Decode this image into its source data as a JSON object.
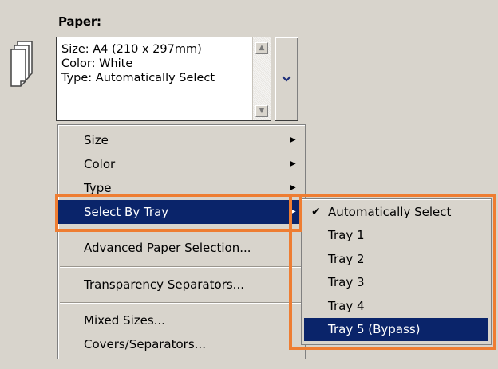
{
  "paper": {
    "title": "Paper:",
    "summary_lines": [
      "Size: A4 (210 x 297mm)",
      "Color: White",
      "Type: Automatically Select"
    ]
  },
  "menu": {
    "items": [
      {
        "label": "Size",
        "submenu": true
      },
      {
        "label": "Color",
        "submenu": true
      },
      {
        "label": "Type",
        "submenu": true
      },
      {
        "label": "Select By Tray",
        "submenu": true,
        "highlighted": true
      },
      {
        "label": "Advanced Paper Selection..."
      },
      {
        "label": "Transparency Separators..."
      },
      {
        "label": "Mixed Sizes..."
      },
      {
        "label": "Covers/Separators..."
      }
    ]
  },
  "submenu": {
    "items": [
      {
        "label": "Automatically Select",
        "checked": true
      },
      {
        "label": "Tray 1"
      },
      {
        "label": "Tray 2"
      },
      {
        "label": "Tray 3"
      },
      {
        "label": "Tray 4"
      },
      {
        "label": "Tray 5 (Bypass)",
        "highlighted": true
      }
    ]
  },
  "colors": {
    "highlight_outline": "#ee7d32",
    "selection": "#0a246a",
    "background": "#d8d4cc"
  }
}
